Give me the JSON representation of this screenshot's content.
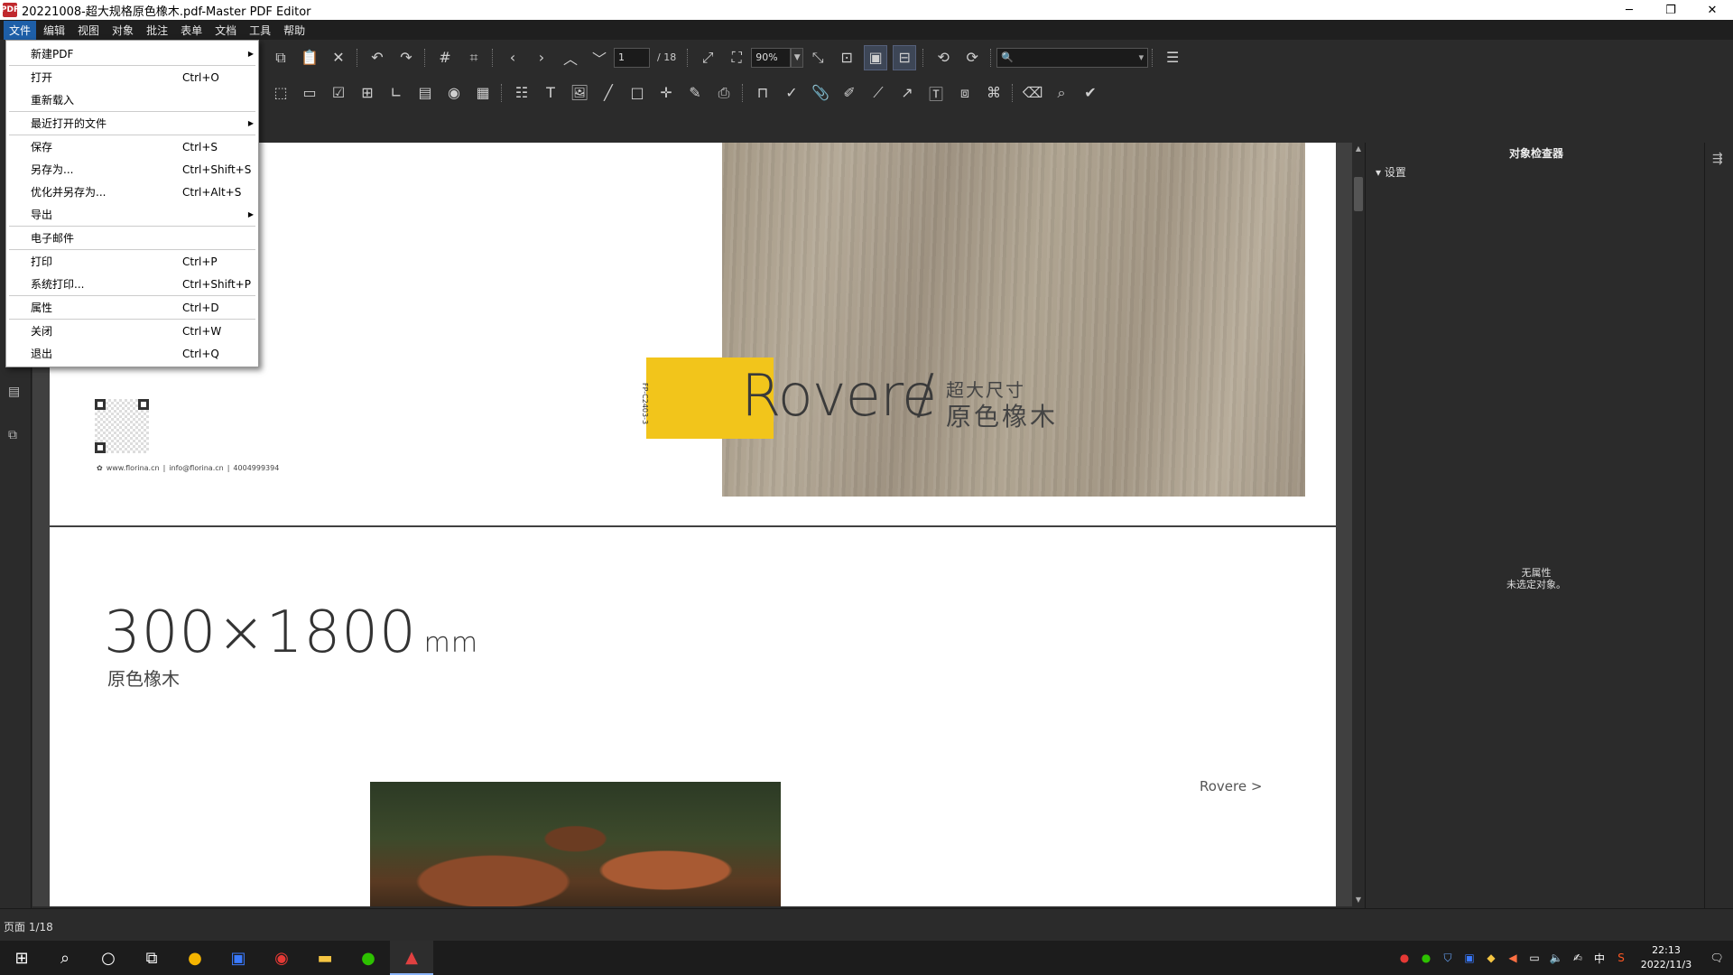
{
  "window": {
    "app_icon": "PDF",
    "title": "20221008-超大规格原色橡木.pdf-Master PDF Editor",
    "minimize": "─",
    "restore": "❐",
    "close": "✕"
  },
  "menubar": [
    "文件",
    "编辑",
    "视图",
    "对象",
    "批注",
    "表单",
    "文档",
    "工具",
    "帮助"
  ],
  "file_menu": [
    {
      "label": "新建PDF",
      "shortcut": "",
      "submenu": true,
      "sep_after": true
    },
    {
      "label": "打开",
      "shortcut": "Ctrl+O",
      "submenu": false,
      "sep_after": false
    },
    {
      "label": "重新载入",
      "shortcut": "",
      "submenu": false,
      "sep_after": true
    },
    {
      "label": "最近打开的文件",
      "shortcut": "",
      "submenu": true,
      "sep_after": true
    },
    {
      "label": "保存",
      "shortcut": "Ctrl+S",
      "submenu": false,
      "sep_after": false
    },
    {
      "label": "另存为...",
      "shortcut": "Ctrl+Shift+S",
      "submenu": false,
      "sep_after": false
    },
    {
      "label": "优化并另存为...",
      "shortcut": "Ctrl+Alt+S",
      "submenu": false,
      "sep_after": false
    },
    {
      "label": "导出",
      "shortcut": "",
      "submenu": true,
      "sep_after": true
    },
    {
      "label": "电子邮件",
      "shortcut": "",
      "submenu": false,
      "sep_after": true
    },
    {
      "label": "打印",
      "shortcut": "Ctrl+P",
      "submenu": false,
      "sep_after": false
    },
    {
      "label": "系统打印...",
      "shortcut": "Ctrl+Shift+P",
      "submenu": false,
      "sep_after": true
    },
    {
      "label": "属性",
      "shortcut": "Ctrl+D",
      "submenu": false,
      "sep_after": true
    },
    {
      "label": "关闭",
      "shortcut": "Ctrl+W",
      "submenu": false,
      "sep_after": false
    },
    {
      "label": "退出",
      "shortcut": "Ctrl+Q",
      "submenu": false,
      "sep_after": false
    }
  ],
  "toolbar": {
    "page_current": "1",
    "page_total": "/ 18",
    "zoom": "90%",
    "search_placeholder": "",
    "search_icon": "🔍"
  },
  "toolbar1_icons": [
    {
      "name": "copy-icon",
      "glyph": "⧉"
    },
    {
      "name": "paste-icon",
      "glyph": "📋"
    },
    {
      "name": "delete-icon",
      "glyph": "✕"
    },
    {
      "sep": true
    },
    {
      "name": "undo-icon",
      "glyph": "↶"
    },
    {
      "name": "redo-icon",
      "glyph": "↷"
    },
    {
      "sep": true
    },
    {
      "name": "grid-icon",
      "glyph": "#"
    },
    {
      "name": "snap-grid-icon",
      "glyph": "⌗"
    },
    {
      "sep": true
    },
    {
      "name": "prev-page-icon",
      "glyph": "‹"
    },
    {
      "name": "next-page-icon",
      "glyph": "›"
    },
    {
      "name": "first-page-icon",
      "glyph": "︿"
    },
    {
      "name": "last-page-icon",
      "glyph": "﹀"
    }
  ],
  "toolbar1_icons_b": [
    {
      "name": "fit-page-icon",
      "glyph": "⤢"
    },
    {
      "name": "actual-size-icon",
      "glyph": "⛶"
    }
  ],
  "toolbar1_icons_c": [
    {
      "name": "fit-width-icon",
      "glyph": "⤡"
    },
    {
      "name": "zoom-region-icon",
      "glyph": "⊡"
    },
    {
      "name": "single-page-icon",
      "glyph": "▣",
      "pressed": true
    },
    {
      "name": "continuous-icon",
      "glyph": "⊟",
      "pressed": true
    },
    {
      "sep": true
    },
    {
      "name": "rotate-left-icon",
      "glyph": "⟲"
    },
    {
      "name": "rotate-right-icon",
      "glyph": "⟳"
    }
  ],
  "toolbar1_icons_d": [
    {
      "sep": true
    },
    {
      "name": "menu-icon",
      "glyph": "☰"
    }
  ],
  "toolbar2_icons": [
    {
      "name": "select-icon",
      "glyph": "⬚"
    },
    {
      "name": "text-field-icon",
      "glyph": "▭"
    },
    {
      "name": "checkbox-icon",
      "glyph": "☑"
    },
    {
      "name": "button-field-icon",
      "glyph": "⊞"
    },
    {
      "name": "list-icon",
      "glyph": "∟"
    },
    {
      "name": "combo-icon",
      "glyph": "▤"
    },
    {
      "name": "radio-icon",
      "glyph": "◉"
    },
    {
      "name": "signature-field-icon",
      "glyph": "▦"
    },
    {
      "sep": true
    },
    {
      "name": "edit-text-icon",
      "glyph": "☷"
    },
    {
      "name": "add-text-icon",
      "glyph": "T"
    },
    {
      "name": "add-image-icon",
      "glyph": "🖼"
    },
    {
      "name": "line-icon",
      "glyph": "╱"
    },
    {
      "name": "rectangle-icon",
      "glyph": "□"
    },
    {
      "name": "shape-icon",
      "glyph": "✛"
    },
    {
      "name": "pencil-icon",
      "glyph": "✎"
    },
    {
      "name": "stamp-icon",
      "glyph": "⎙"
    },
    {
      "sep": true
    },
    {
      "name": "highlight-box-icon",
      "glyph": "⊓"
    },
    {
      "name": "checkmark-icon",
      "glyph": "✓"
    },
    {
      "name": "attach-icon",
      "glyph": "📎"
    },
    {
      "name": "highlighter-icon",
      "glyph": "✐"
    },
    {
      "name": "draw-line-icon",
      "glyph": "⟋"
    },
    {
      "name": "arrow-icon",
      "glyph": "↗"
    },
    {
      "name": "text-box-icon",
      "glyph": "🅃"
    },
    {
      "name": "measure-icon",
      "glyph": "⧈"
    },
    {
      "name": "link-icon",
      "glyph": "⌘"
    },
    {
      "sep": true
    },
    {
      "name": "eraser-icon",
      "glyph": "⌫"
    },
    {
      "name": "search-text-icon",
      "glyph": "⌕"
    },
    {
      "name": "approve-icon",
      "glyph": "✔"
    }
  ],
  "document": {
    "code": "FP-C2403-3",
    "brand": "Rovere",
    "slash": "/",
    "cn_small": "超大尺寸",
    "cn_large": "原色橡木",
    "contact": [
      "www.florina.cn",
      "|",
      "info@florina.cn",
      "|",
      "4004999394"
    ],
    "dims": "300×1800",
    "unit": "mm",
    "dims_sub": "原色橡木",
    "link": "Rovere >"
  },
  "right_panel": {
    "title": "对象检查器",
    "settings": "设置",
    "message_line1": "无属性",
    "message_line2": "未选定对象。"
  },
  "statusbar": {
    "text": "页面 1/18"
  },
  "taskbar": {
    "time": "22:13",
    "date": "2022/11/3",
    "ime": "中"
  },
  "colors": {
    "accent": "#1e5fa8",
    "brand_yellow": "#f2c51b",
    "app_red": "#c0282d"
  }
}
